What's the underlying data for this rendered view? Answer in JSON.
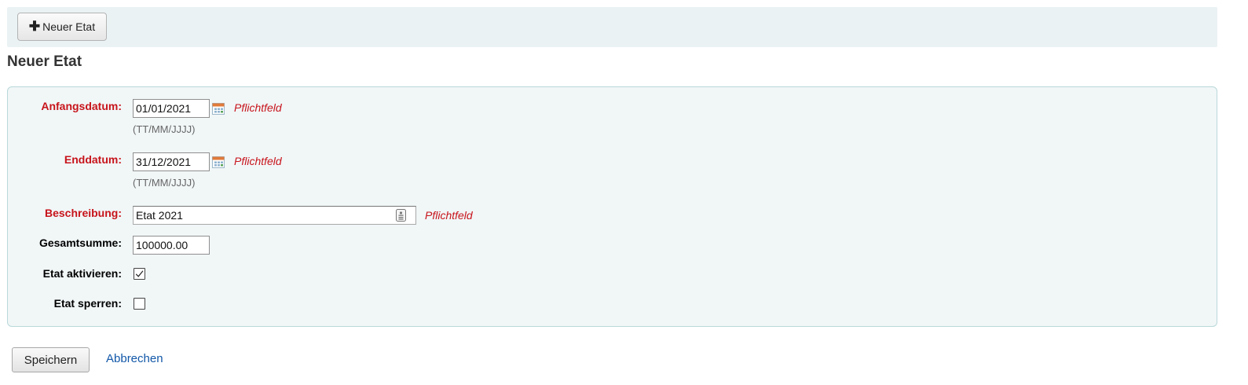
{
  "toolbar": {
    "new_button_label": "Neuer Etat",
    "new_button_icon": "plus-icon"
  },
  "page": {
    "title": "Neuer Etat"
  },
  "form": {
    "start_date": {
      "label": "Anfangsdatum:",
      "value": "01/01/2021",
      "hint": "(TT/MM/JJJJ)",
      "required_note": "Pflichtfeld"
    },
    "end_date": {
      "label": "Enddatum:",
      "value": "31/12/2021",
      "hint": "(TT/MM/JJJJ)",
      "required_note": "Pflichtfeld"
    },
    "description": {
      "label": "Beschreibung:",
      "value": "Etat 2021",
      "required_note": "Pflichtfeld"
    },
    "total": {
      "label": "Gesamtsumme:",
      "value": "100000.00"
    },
    "activate": {
      "label": "Etat aktivieren:",
      "checked": true
    },
    "lock": {
      "label": "Etat sperren:",
      "checked": false
    }
  },
  "actions": {
    "save_label": "Speichern",
    "cancel_label": "Abbrechen"
  },
  "colors": {
    "required": "#c7141b",
    "link": "#1157a8",
    "panel_bg": "#f1f6f7",
    "toolbar_bg": "#eaf2f4"
  }
}
